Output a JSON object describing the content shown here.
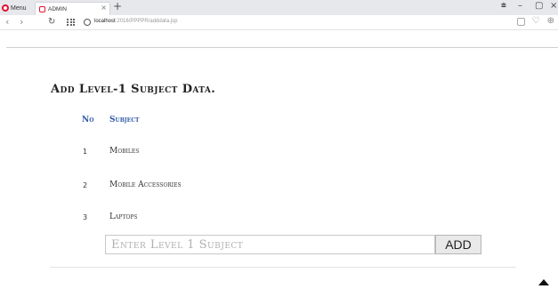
{
  "browser": {
    "menu_label": "Menu",
    "tab_title": "ADMIN",
    "tab_close": "×",
    "new_tab": "+",
    "url_host": "localhost",
    "url_path": ":2016/PPPPR/adddata.jsp",
    "window_controls": [
      "⩧",
      "–",
      "▢",
      "×"
    ]
  },
  "page": {
    "title": "Add Level-1 Subject Data.",
    "table": {
      "headers": {
        "no": "No",
        "subject": "Subject"
      },
      "rows": [
        {
          "no": "1",
          "subject": "Mobiles"
        },
        {
          "no": "2",
          "subject": "Mobile Accessories"
        },
        {
          "no": "3",
          "subject": "Laptops"
        }
      ]
    },
    "form": {
      "input_placeholder": "Enter Level 1 Subject",
      "input_value": "",
      "add_label": "ADD"
    }
  },
  "colors": {
    "header_accent": "#2f5aa6",
    "brand_red": "#e8112d"
  }
}
